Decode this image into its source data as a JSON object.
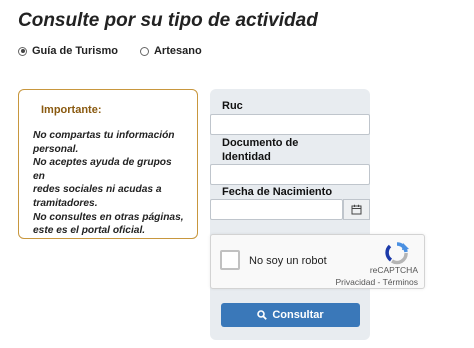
{
  "header": {
    "title": "Consulte por su tipo de actividad"
  },
  "activity_type": {
    "options": [
      {
        "label": "Guía de Turismo",
        "selected": true
      },
      {
        "label": "Artesano",
        "selected": false
      }
    ]
  },
  "notice": {
    "title": "Importante:",
    "lines": [
      "No compartas tu información",
      "personal.",
      "No aceptes ayuda de grupos en",
      "redes sociales ni acudas a",
      "tramitadores.",
      "No consultes en otras páginas,",
      "este es el portal oficial."
    ],
    "border_color": "#c8973e",
    "title_color": "#8a5a10"
  },
  "form": {
    "ruc_label": "Ruc",
    "ruc_value": "",
    "document_label_line1": "Documento de",
    "document_label_line2": "Identidad",
    "document_value": "",
    "birthdate_label": "Fecha de Nacimiento",
    "birthdate_value": "",
    "calendar_icon": "calendar-icon"
  },
  "captcha": {
    "label": "No soy un robot",
    "brand": "reCAPTCHA",
    "links": "Privacidad - Términos",
    "checked": false
  },
  "submit": {
    "label": "Consultar",
    "icon": "search-icon",
    "color": "#3a78b9"
  }
}
